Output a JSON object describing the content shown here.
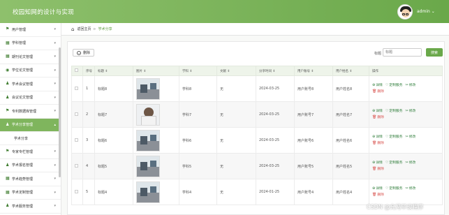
{
  "header": {
    "app_title": "校园知网的设计与实现",
    "username": "admin",
    "user_dropdown": "⌄"
  },
  "sidebar": {
    "items": [
      {
        "label": "用户管理",
        "icon": "flag-icon"
      },
      {
        "label": "学科管理",
        "icon": "grid-icon"
      },
      {
        "label": "期刊论文管理",
        "icon": "grid-icon"
      },
      {
        "label": "学位论文管理",
        "icon": "location-icon"
      },
      {
        "label": "学术会议管理",
        "icon": "user-icon"
      },
      {
        "label": "会议论文管理",
        "icon": "user-icon"
      },
      {
        "label": "专利数据库管理",
        "icon": "flag-icon"
      },
      {
        "label": "学术分享管理",
        "icon": "user-icon"
      },
      {
        "label": "专家专栏管理",
        "icon": "flag-icon"
      },
      {
        "label": "学术报名管理",
        "icon": "user-icon"
      },
      {
        "label": "学术趋势管理",
        "icon": "grid-icon"
      },
      {
        "label": "学术定制管理",
        "icon": "grid-icon"
      },
      {
        "label": "学术服务管理",
        "icon": "user-icon"
      }
    ],
    "sub_item": "学术分享"
  },
  "breadcrumb": {
    "home": "返回主页",
    "separator": "⊳",
    "current": "学术分享"
  },
  "toolbar": {
    "delete_label": "删除",
    "search_label": "标题",
    "search_placeholder": "标题",
    "search_button": "搜索"
  },
  "table": {
    "headers": [
      "",
      "序号",
      "标题 ⇕",
      "图片 ⇕",
      "学科 ⇕",
      "文献 ⇕",
      "分享时间 ⇕",
      "用户账号 ⇕",
      "用户姓名 ⇕",
      "操作"
    ],
    "rows": [
      {
        "index": "1",
        "title": "标题8",
        "subject": "学科8",
        "doc": "无",
        "time": "2024-03-25",
        "account": "用户账号8",
        "name": "用户姓名8",
        "img": "lab"
      },
      {
        "index": "2",
        "title": "标题7",
        "subject": "学科7",
        "doc": "无",
        "time": "2024-03-25",
        "account": "用户账号7",
        "name": "用户姓名7",
        "img": "person"
      },
      {
        "index": "3",
        "title": "标题6",
        "subject": "学科6",
        "doc": "无",
        "time": "2024-03-25",
        "account": "用户账号6",
        "name": "用户姓名6",
        "img": "lab"
      },
      {
        "index": "4",
        "title": "标题5",
        "subject": "学科5",
        "doc": "无",
        "time": "2024-03-25",
        "account": "用户账号5",
        "name": "用户姓名5",
        "img": "lab"
      },
      {
        "index": "5",
        "title": "标题4",
        "subject": "学科4",
        "doc": "无",
        "time": "2024-01-25",
        "account": "用户账号4",
        "name": "用户姓名4",
        "img": "lab"
      }
    ],
    "actions": {
      "detail": "详情",
      "custom": "定制服务",
      "edit": "修改",
      "delete": "删除"
    }
  },
  "watermark": "CSDN @允冯毕设程序",
  "colors": {
    "brand": "#6aa84a",
    "active_menu": "#7fb55d",
    "delete": "#d9534f"
  }
}
